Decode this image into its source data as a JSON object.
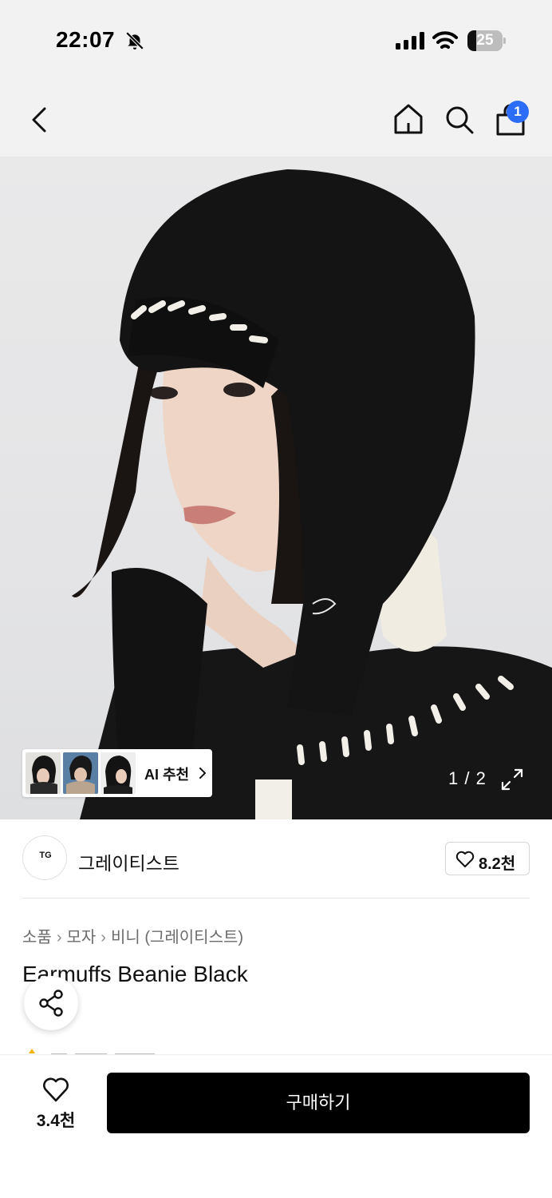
{
  "status_bar": {
    "time": "22:07",
    "battery_level": "25",
    "battery_fraction": 0.25
  },
  "nav": {
    "cart_badge": "1"
  },
  "gallery": {
    "ai_label": "AI 추천",
    "page_indicator": "1 / 2"
  },
  "brand": {
    "logo_text": "TG",
    "name": "그레이티스트",
    "like_count": "8.2천"
  },
  "breadcrumb": [
    "소품",
    "모자",
    "비니 (그레이티스트)"
  ],
  "product": {
    "title": "Earmuffs Beanie Black"
  },
  "bottom_bar": {
    "wish_count": "3.4천",
    "buy_label": "구매하기"
  },
  "colors": {
    "accent_badge": "#2b6df6",
    "buy_button": "#000000"
  }
}
